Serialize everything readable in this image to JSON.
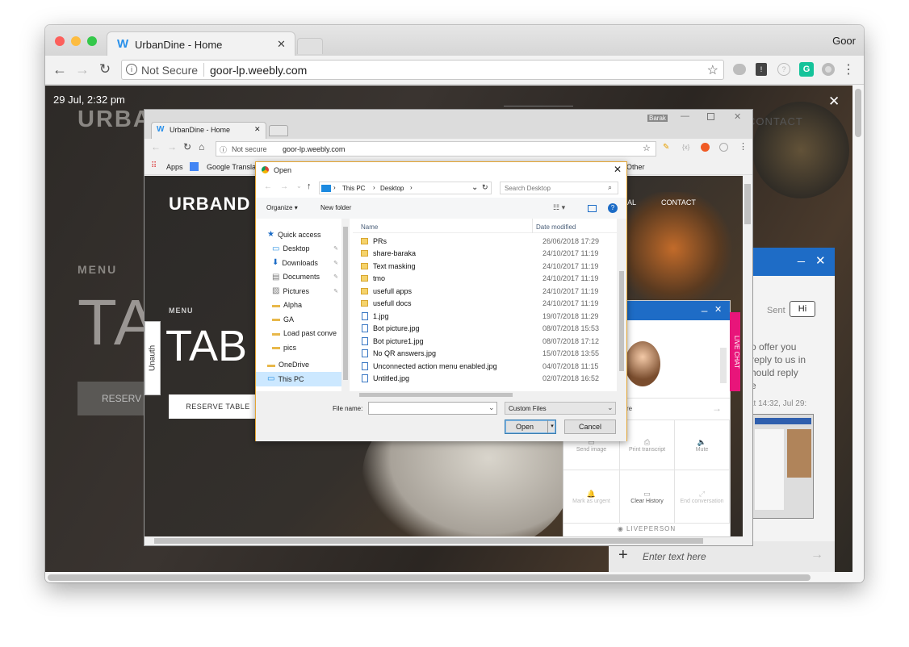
{
  "outer_browser": {
    "tab_title": "UrbanDine - Home",
    "profile": "Goor",
    "security": "Not Secure",
    "url": "goor-lp.weebly.com",
    "colors": {
      "red": "#fc605c",
      "yellow": "#fdbc40",
      "green": "#34c84a"
    }
  },
  "overlay": {
    "timestamp": "29 Jul, 2:32 pm",
    "close_glyph": "✕"
  },
  "bg_site": {
    "logo": "URBA",
    "menu_label": "MENU",
    "big_title": "TA",
    "reserve": "RESERV",
    "contact": "CONTACT",
    "unauth": "Unauth"
  },
  "inner_browser": {
    "tab_title": "UrbanDine - Home",
    "profile": "Barak",
    "security": "Not secure",
    "url": "goor-lp.weebly.com",
    "bookmarks": [
      "Apps",
      "Google Translat",
      "Other"
    ]
  },
  "inner_site": {
    "logo": "URBAND",
    "contact": "CONTACT",
    "nav_partial": "AL",
    "menu_label": "MENU",
    "big_title": "TAB",
    "reserve_button": "RESERVE TABLE"
  },
  "dialog": {
    "title": "Open",
    "path": [
      "This PC",
      "Desktop"
    ],
    "search_placeholder": "Search Desktop",
    "organize": "Organize",
    "new_folder": "New folder",
    "columns": {
      "name": "Name",
      "date": "Date modified"
    },
    "nav": [
      {
        "label": "Quick access",
        "icon": "star-icon",
        "pin": false
      },
      {
        "label": "Desktop",
        "icon": "desktop-icon",
        "pin": true
      },
      {
        "label": "Downloads",
        "icon": "download-icon",
        "pin": true
      },
      {
        "label": "Documents",
        "icon": "document-icon",
        "pin": true
      },
      {
        "label": "Pictures",
        "icon": "pictures-icon",
        "pin": true
      },
      {
        "label": "Alpha",
        "icon": "folder-icon",
        "pin": false
      },
      {
        "label": "GA",
        "icon": "folder-icon",
        "pin": false
      },
      {
        "label": "Load past conve",
        "icon": "folder-icon",
        "pin": false
      },
      {
        "label": "pics",
        "icon": "folder-icon",
        "pin": false
      },
      {
        "label": "OneDrive",
        "icon": "folder-icon",
        "pin": false
      },
      {
        "label": "This PC",
        "icon": "pc-icon",
        "pin": false
      }
    ],
    "files": [
      {
        "name": "PRs",
        "date": "26/06/2018 17:29",
        "kind": "folder"
      },
      {
        "name": "share-baraka",
        "date": "24/10/2017 11:19",
        "kind": "folder"
      },
      {
        "name": "Text masking",
        "date": "24/10/2017 11:19",
        "kind": "folder"
      },
      {
        "name": "tmo",
        "date": "24/10/2017 11:19",
        "kind": "folder"
      },
      {
        "name": "usefull apps",
        "date": "24/10/2017 11:19",
        "kind": "folder"
      },
      {
        "name": "usefull docs",
        "date": "24/10/2017 11:19",
        "kind": "folder"
      },
      {
        "name": "1.jpg",
        "date": "19/07/2018 11:29",
        "kind": "image"
      },
      {
        "name": "Bot picture.jpg",
        "date": "08/07/2018 15:53",
        "kind": "image"
      },
      {
        "name": "Bot picture1.jpg",
        "date": "08/07/2018 17:12",
        "kind": "image"
      },
      {
        "name": "No QR answers.jpg",
        "date": "15/07/2018 13:55",
        "kind": "image"
      },
      {
        "name": "Unconnected action menu enabled.jpg",
        "date": "04/07/2018 11:15",
        "kind": "image"
      },
      {
        "name": "Untitled.jpg",
        "date": "02/07/2018 16:52",
        "kind": "image"
      }
    ],
    "filename_label": "File name:",
    "filename_value": "",
    "filetype": "Custom Files",
    "open": "Open",
    "cancel": "Cancel"
  },
  "chat_small": {
    "minimize": "_",
    "close": "✕",
    "side_tab": "LIVE CHAT",
    "input_partial": "re",
    "actions": [
      {
        "label": "Send image",
        "icon": "image-icon"
      },
      {
        "label": "Print transcript",
        "icon": "print-icon"
      },
      {
        "label": "Mute",
        "icon": "speaker-icon"
      },
      {
        "label": "Mark as urgent",
        "icon": "bell-icon"
      },
      {
        "label": "Clear History",
        "icon": "clear-icon"
      },
      {
        "label": "End conversation",
        "icon": "end-icon"
      }
    ],
    "brand": "LIVEPERSON"
  },
  "chat_large": {
    "minimize": "_",
    "close": "✕",
    "sent_label": "Sent",
    "bubble": "Hi",
    "message_lines": [
      "o offer you",
      "reply to us in",
      "hould reply",
      "e"
    ],
    "timestamp": "at 14:32, Jul 29:",
    "input_placeholder": "Enter text here",
    "plus": "+"
  }
}
